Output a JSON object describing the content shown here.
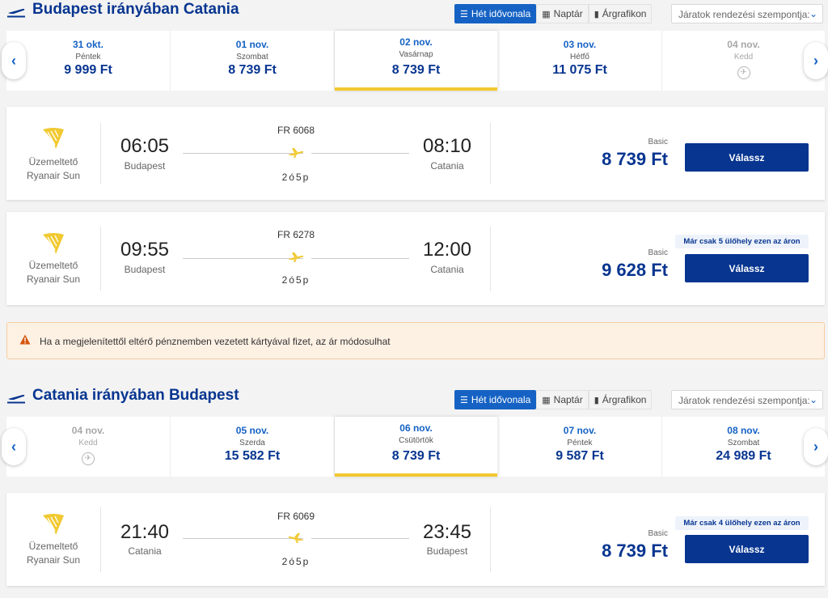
{
  "colors": {
    "brand": "#073590",
    "accent": "#1562c4",
    "yellow": "#f1c931",
    "warning": "#d6550d"
  },
  "outbound": {
    "title": "Budapest irányában Catania",
    "tabs": [
      "Hét idővonala",
      "Naptár",
      "Árgrafikon"
    ],
    "sort_placeholder": "Járatok rendezési szempontja:",
    "dates": [
      {
        "date": "31 okt.",
        "day": "Péntek",
        "price": "9 999 Ft",
        "state": "normal"
      },
      {
        "date": "01 nov.",
        "day": "Szombat",
        "price": "8 739 Ft",
        "state": "normal"
      },
      {
        "date": "02 nov.",
        "day": "Vasárnap",
        "price": "8 739 Ft",
        "state": "selected"
      },
      {
        "date": "03 nov.",
        "day": "Hétfő",
        "price": "11 075 Ft",
        "state": "normal"
      },
      {
        "date": "04 nov.",
        "day": "Kedd",
        "price": "",
        "state": "unavailable"
      }
    ],
    "flights": [
      {
        "operator_label": "Üzemeltető",
        "operator": "Ryanair Sun",
        "flight_no": "FR 6068",
        "dep_time": "06:05",
        "dep_city": "Budapest",
        "arr_time": "08:10",
        "arr_city": "Catania",
        "duration": "2ó5p",
        "fare": "Basic",
        "price": "8 739 Ft",
        "badge": "",
        "cta": "Válassz"
      },
      {
        "operator_label": "Üzemeltető",
        "operator": "Ryanair Sun",
        "flight_no": "FR 6278",
        "dep_time": "09:55",
        "dep_city": "Budapest",
        "arr_time": "12:00",
        "arr_city": "Catania",
        "duration": "2ó5p",
        "fare": "Basic",
        "price": "9 628 Ft",
        "badge": "Már csak 5 ülőhely ezen az áron",
        "cta": "Válassz"
      }
    ]
  },
  "notice": {
    "text": "Ha a megjelenítettől eltérő pénznemben vezetett kártyával fizet, az ár módosulhat"
  },
  "inbound": {
    "title": "Catania irányában Budapest",
    "tabs": [
      "Hét idővonala",
      "Naptár",
      "Árgrafikon"
    ],
    "sort_placeholder": "Járatok rendezési szempontja:",
    "dates": [
      {
        "date": "04 nov.",
        "day": "Kedd",
        "price": "",
        "state": "unavailable"
      },
      {
        "date": "05 nov.",
        "day": "Szerda",
        "price": "15 582 Ft",
        "state": "normal"
      },
      {
        "date": "06 nov.",
        "day": "Csütörtök",
        "price": "8 739 Ft",
        "state": "selected"
      },
      {
        "date": "07 nov.",
        "day": "Péntek",
        "price": "9 587 Ft",
        "state": "normal"
      },
      {
        "date": "08 nov.",
        "day": "Szombat",
        "price": "24 989 Ft",
        "state": "normal"
      }
    ],
    "flights": [
      {
        "operator_label": "Üzemeltető",
        "operator": "Ryanair Sun",
        "flight_no": "FR 6069",
        "dep_time": "21:40",
        "dep_city": "Catania",
        "arr_time": "23:45",
        "arr_city": "Budapest",
        "duration": "2ó5p",
        "fare": "Basic",
        "price": "8 739 Ft",
        "badge": "Már csak 4 ülőhely ezen az áron",
        "cta": "Válassz"
      }
    ]
  }
}
